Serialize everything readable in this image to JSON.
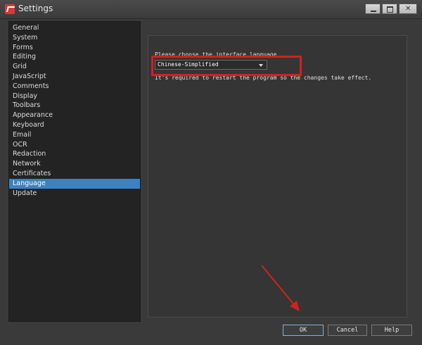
{
  "window": {
    "title": "Settings",
    "accent_color": "#3b82c4",
    "highlight_color": "#d32020"
  },
  "title_buttons": {
    "minimize_icon": "minimize-icon",
    "restore_icon": "restore-icon",
    "close_icon": "close-icon",
    "close_glyph": "✕"
  },
  "sidebar": {
    "items": [
      {
        "label": "General"
      },
      {
        "label": "System"
      },
      {
        "label": "Forms"
      },
      {
        "label": "Editing"
      },
      {
        "label": "Grid"
      },
      {
        "label": "JavaScript"
      },
      {
        "label": "Comments"
      },
      {
        "label": "Display"
      },
      {
        "label": "Toolbars"
      },
      {
        "label": "Appearance"
      },
      {
        "label": "Keyboard"
      },
      {
        "label": "Email"
      },
      {
        "label": "OCR"
      },
      {
        "label": "Redaction"
      },
      {
        "label": "Network"
      },
      {
        "label": "Certificates"
      },
      {
        "label": "Language"
      },
      {
        "label": "Update"
      }
    ],
    "selected": "Language"
  },
  "language_panel": {
    "prompt": "Please choose the interface language",
    "selected_language": "Chinese-Simplified",
    "restart_note": "It's required to restart the program so the changes take effect."
  },
  "footer": {
    "ok_label": "OK",
    "cancel_label": "Cancel",
    "help_label": "Help"
  }
}
